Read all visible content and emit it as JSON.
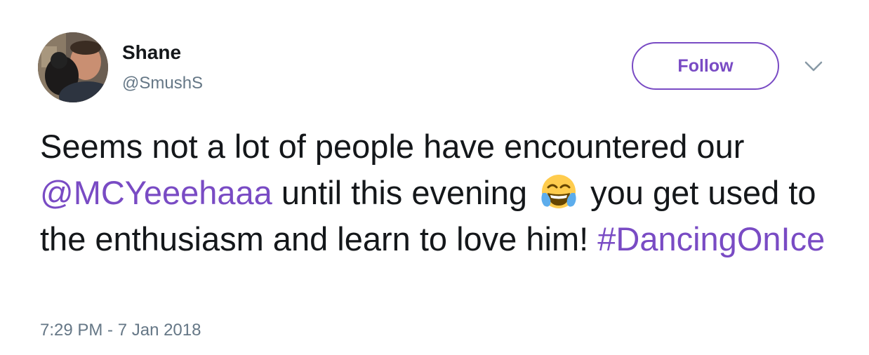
{
  "author": {
    "name": "Shane",
    "handle": "@SmushS",
    "avatar_icon": "profile-photo"
  },
  "actions": {
    "follow_label": "Follow",
    "more_icon": "chevron-down-icon"
  },
  "tweet": {
    "text_1": "Seems not a lot of people have encountered our ",
    "mention": "@MCYeeehaaa",
    "text_2": " until this evening ",
    "emoji": "face-with-tears-of-joy",
    "text_3": " you get used to the enthusiasm and learn to love him! ",
    "hashtag": "#DancingOnIce"
  },
  "timestamp": "7:29 PM - 7 Jan 2018",
  "colors": {
    "accent": "#794bc4",
    "secondary_text": "#657786",
    "primary_text": "#14171a"
  }
}
